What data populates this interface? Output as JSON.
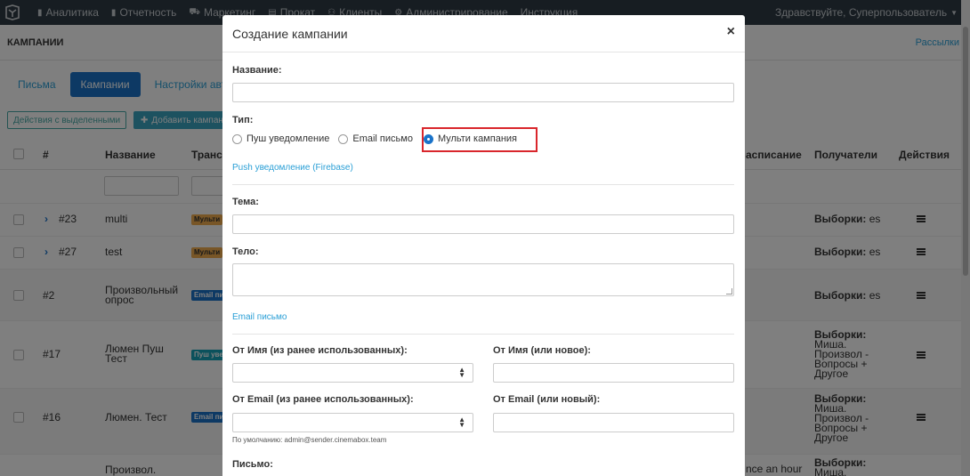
{
  "nav": {
    "items": [
      {
        "icon": "bar-chart-icon",
        "label": "Аналитика"
      },
      {
        "icon": "bar-chart-icon",
        "label": "Отчетность"
      },
      {
        "icon": "cart-icon",
        "label": "Маркетинг"
      },
      {
        "icon": "doc-icon",
        "label": "Прокат"
      },
      {
        "icon": "users-icon",
        "label": "Клиенты"
      },
      {
        "icon": "gear-icon",
        "label": "Администрирование"
      },
      {
        "icon": "",
        "label": "Инструкция"
      }
    ],
    "greeting": "Здравствуйте, Суперпользователь"
  },
  "page": {
    "title": "КАМПАНИИ",
    "right_link": "Рассылки"
  },
  "tabs": [
    {
      "label": "Письма",
      "active": false
    },
    {
      "label": "Кампании",
      "active": true
    },
    {
      "label": "Настройки авто к",
      "active": false
    }
  ],
  "actions": {
    "bulk": "Действия с выделенными",
    "add": "Добавить кампан"
  },
  "table": {
    "headers": {
      "num": "#",
      "name": "Название",
      "transport": "Трансп",
      "schedule": "асписание",
      "recipients": "Получатели",
      "actions": "Действия"
    },
    "rows": [
      {
        "num": "#23",
        "name": "multi",
        "badge": "Мульти",
        "badge_color": "#f0ad4e",
        "expand": true,
        "recipients_label": "Выборки:",
        "recipients_value": "es",
        "schedule": ""
      },
      {
        "num": "#27",
        "name": "test",
        "badge": "Мульти",
        "badge_color": "#f0ad4e",
        "expand": true,
        "recipients_label": "Выборки:",
        "recipients_value": "es",
        "schedule": ""
      },
      {
        "num": "#2",
        "name": "Произвольный опрос",
        "badge": "Email пи",
        "badge_color": "#1a73c9",
        "expand": false,
        "recipients_label": "Выборки:",
        "recipients_value": "es",
        "schedule": ""
      },
      {
        "num": "#17",
        "name": "Люмен Пуш Тест",
        "badge": "Пуш уве",
        "badge_color": "#17a2b8",
        "expand": false,
        "recipients_label": "Выборки:",
        "recipients_value": "Миша. Произвол - Вопросы + Другое",
        "schedule": ""
      },
      {
        "num": "#16",
        "name": "Люмен. Тест",
        "badge": "Email пи",
        "badge_color": "#1a73c9",
        "expand": false,
        "recipients_label": "Выборки:",
        "recipients_value": "Миша. Произвол - Вопросы + Другое",
        "schedule": ""
      },
      {
        "num": "",
        "name": "Произвол.",
        "badge": "",
        "badge_color": "",
        "expand": false,
        "recipients_label": "Выборки:",
        "recipients_value": "Миша.",
        "schedule": "nce an hour"
      }
    ]
  },
  "modal": {
    "title": "Создание кампании",
    "close": "×",
    "name_label": "Название:",
    "type_label": "Тип:",
    "type_options": [
      {
        "label": "Пуш уведомление",
        "selected": false
      },
      {
        "label": "Email письмо",
        "selected": false
      },
      {
        "label": "Мульти кампания",
        "selected": true
      }
    ],
    "push_section": "Push уведомление (Firebase)",
    "subject_label": "Тема:",
    "body_label": "Тело:",
    "email_section": "Email письмо",
    "from_name_prev_label": "От Имя (из ранее использованных):",
    "from_name_new_label": "От Имя (или новое):",
    "from_email_prev_label": "От Email (из ранее использованных):",
    "from_email_new_label": "От Email (или новый):",
    "default_hint": "По умолчанию: admin@sender.cinemabox.team",
    "letter_label": "Письмо:"
  },
  "colors": {
    "navbar": "#2f3a45",
    "primary": "#1a73c9",
    "link": "#2a9fd6",
    "highlight": "#d9262c"
  }
}
